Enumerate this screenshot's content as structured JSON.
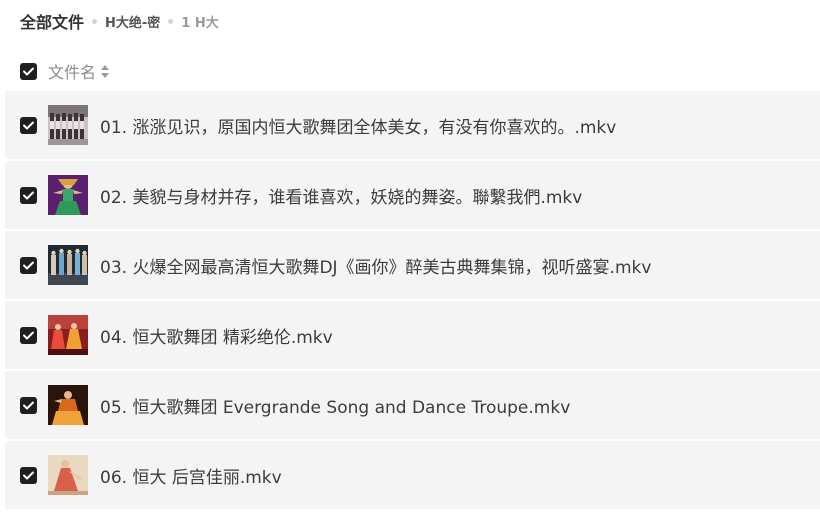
{
  "breadcrumb": {
    "root": "全部文件",
    "folder": "H大绝-密",
    "current": "1 H大"
  },
  "header": {
    "column_label": "文件名",
    "sort_icon": "sort-updown-icon"
  },
  "files": [
    {
      "name": "01. 涨涨见识，原国内恒大歌舞团全体美女，有没有你喜欢的。.mkv",
      "checked": true,
      "thumb": "video-thumbnail"
    },
    {
      "name": "02. 美貌与身材并存，谁看谁喜欢，妖娆的舞姿。聯繫我們.mkv",
      "checked": true,
      "thumb": "video-thumbnail"
    },
    {
      "name": "03. 火爆全网最高清恒大歌舞DJ《画你》醉美古典舞集锦，视听盛宴.mkv",
      "checked": true,
      "thumb": "video-thumbnail"
    },
    {
      "name": "04. 恒大歌舞团 精彩绝伦.mkv",
      "checked": true,
      "thumb": "video-thumbnail"
    },
    {
      "name": "05. 恒大歌舞团 Evergrande Song and Dance Troupe.mkv",
      "checked": true,
      "thumb": "video-thumbnail"
    },
    {
      "name": "06. 恒大 后宫佳丽.mkv",
      "checked": true,
      "thumb": "video-thumbnail"
    }
  ],
  "colors": {
    "checkbox": "#1f1f1f",
    "row_background": "#f4f4f4",
    "text": "#3c3c3c",
    "muted_text": "#8c8c8c"
  }
}
